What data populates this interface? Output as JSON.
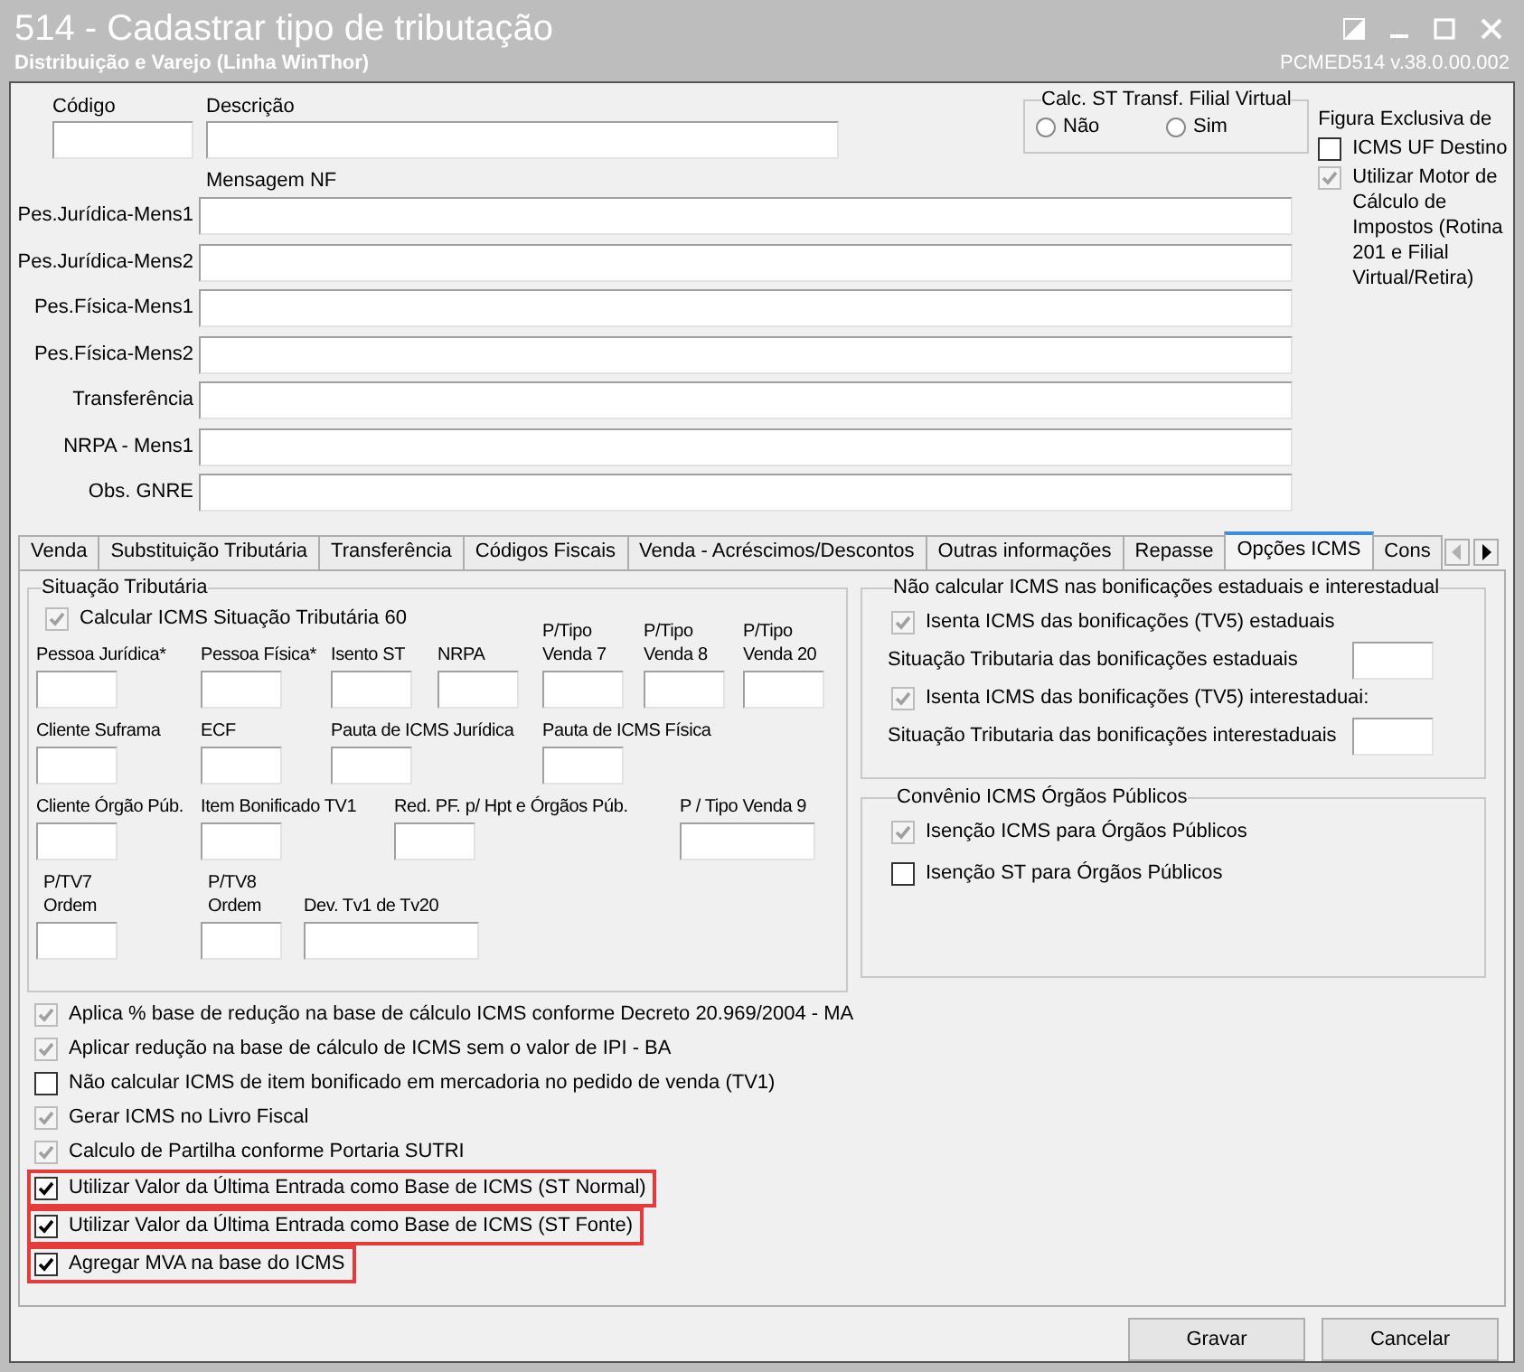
{
  "window": {
    "title": "514 - Cadastrar tipo de tributação",
    "subtitle": "Distribuição e Varejo (Linha WinThor)",
    "program": "PCMED514  v.38.0.00.002"
  },
  "header": {
    "codigo": {
      "label": "Código"
    },
    "descricao": {
      "label": "Descrição"
    },
    "calc_st": {
      "legend": "Calc. ST Transf. Filial Virtual",
      "options": [
        {
          "label": "Não",
          "selected": false
        },
        {
          "label": "Sim",
          "selected": false
        }
      ]
    },
    "figura": {
      "title": "Figura Exclusiva de",
      "options": [
        {
          "label": "ICMS UF Destino",
          "checked": false,
          "disabled": false
        },
        {
          "label": "Utilizar Motor de Cálculo de Impostos (Rotina 201 e Filial Virtual/Retira)",
          "checked": true,
          "disabled": true
        }
      ]
    }
  },
  "mensagem_nf": {
    "heading": "Mensagem NF",
    "rows": [
      {
        "label": "Pes.Jurídica-Mens1"
      },
      {
        "label": "Pes.Jurídica-Mens2"
      },
      {
        "label": "Pes.Física-Mens1"
      },
      {
        "label": "Pes.Física-Mens2"
      },
      {
        "label": "Transferência"
      },
      {
        "label": "NRPA - Mens1"
      },
      {
        "label": "Obs. GNRE"
      }
    ]
  },
  "tabs": [
    {
      "label": "Venda",
      "selected": false
    },
    {
      "label": "Substituição Tributária",
      "selected": false
    },
    {
      "label": "Transferência",
      "selected": false
    },
    {
      "label": "Códigos Fiscais",
      "selected": false
    },
    {
      "label": "Venda - Acréscimos/Descontos",
      "selected": false
    },
    {
      "label": "Outras informações",
      "selected": false
    },
    {
      "label": "Repasse",
      "selected": false
    },
    {
      "label": "Opções ICMS",
      "selected": true
    },
    {
      "label": "Cons",
      "selected": false
    }
  ],
  "situacao": {
    "legend": "Situação Tributária",
    "check": {
      "label": "Calcular ICMS Situação Tributária 60",
      "checked": true,
      "disabled": true
    },
    "field_rows": [
      [
        {
          "label": "Pessoa Jurídica*"
        },
        {
          "label": "Pessoa Física*"
        },
        {
          "label": "Isento ST"
        },
        {
          "label": "NRPA"
        },
        {
          "label": "P/Tipo Venda 7"
        },
        {
          "label": "P/Tipo Venda 8"
        },
        {
          "label": "P/Tipo Venda 20"
        }
      ],
      [
        {
          "label": "Cliente Suframa"
        },
        {
          "label": "ECF"
        },
        {
          "label": "Pauta de ICMS Jurídica"
        },
        {
          "label": "Pauta de ICMS Física"
        }
      ],
      [
        {
          "label": "Cliente Órgão Púb."
        },
        {
          "label": "Item Bonificado TV1"
        },
        {
          "label": "Red. PF. p/ Hpt e Órgãos Púb."
        },
        {
          "label": "P / Tipo Venda 9"
        }
      ],
      [
        {
          "label": "P/TV7 Ordem"
        },
        {
          "label": "P/TV8 Ordem"
        },
        {
          "label": "Dev. Tv1 de Tv20"
        }
      ]
    ]
  },
  "bonificacoes": {
    "legend": "Não calcular ICMS nas bonificações estaduais e interestadual",
    "items": [
      {
        "kind": "check",
        "label": "Isenta ICMS das bonificações (TV5) estaduais",
        "checked": true,
        "disabled": true
      },
      {
        "kind": "field",
        "label": "Situação Tributaria das bonificações estaduais"
      },
      {
        "kind": "check",
        "label": "Isenta ICMS das bonificações (TV5) interestaduai:",
        "checked": true,
        "disabled": true
      },
      {
        "kind": "field",
        "label": "Situação Tributaria das bonificações interestaduais"
      }
    ]
  },
  "convenio": {
    "legend": "Convênio ICMS Órgãos Públicos",
    "items": [
      {
        "label": "Isenção ICMS para Órgãos Públicos",
        "checked": true,
        "disabled": true
      },
      {
        "label": "Isenção ST para Órgãos Públicos",
        "checked": false,
        "disabled": false
      }
    ]
  },
  "options": [
    {
      "label": "Aplica % base de redução na base de cálculo ICMS conforme Decreto 20.969/2004 - MA",
      "checked": true,
      "disabled": true,
      "highlighted": false
    },
    {
      "label": "Aplicar redução na base de cálculo de ICMS sem o valor de IPI - BA",
      "checked": true,
      "disabled": true,
      "highlighted": false
    },
    {
      "label": "Não calcular ICMS de item bonificado em mercadoria no pedido de venda (TV1)",
      "checked": false,
      "disabled": false,
      "highlighted": false
    },
    {
      "label": "Gerar ICMS no Livro Fiscal",
      "checked": true,
      "disabled": true,
      "highlighted": false
    },
    {
      "label": "Calculo de Partilha conforme Portaria SUTRI",
      "checked": true,
      "disabled": true,
      "highlighted": false
    },
    {
      "label": "Utilizar Valor da Última Entrada como Base de ICMS (ST Normal)",
      "checked": true,
      "disabled": false,
      "highlighted": true
    },
    {
      "label": "Utilizar Valor da Última Entrada como Base de ICMS (ST Fonte)",
      "checked": true,
      "disabled": false,
      "highlighted": true
    },
    {
      "label": "Agregar MVA na base do ICMS",
      "checked": true,
      "disabled": false,
      "highlighted": true
    }
  ],
  "buttons": [
    {
      "label": "Gravar"
    },
    {
      "label": "Cancelar"
    }
  ]
}
